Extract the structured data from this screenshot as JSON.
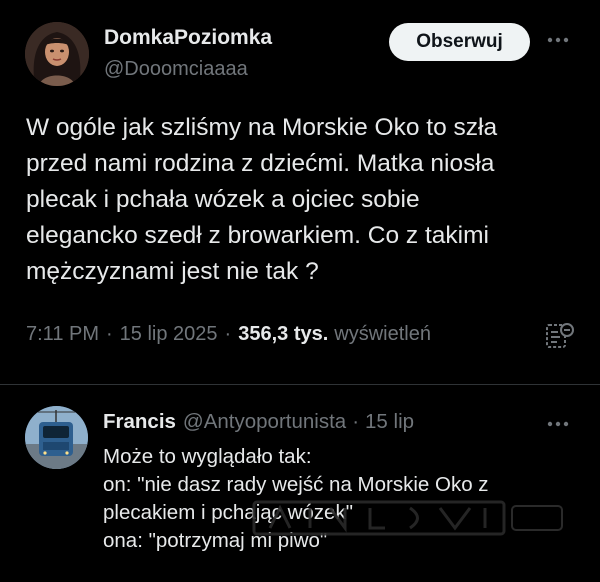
{
  "main_tweet": {
    "author_name": "DomkaPoziomka",
    "author_handle": "@Dooomciaaaa",
    "follow_label": "Obserwuj",
    "text_lines": [
      "W ogóle jak szliśmy na Morskie Oko to szła",
      "przed nami rodzina z dziećmi. Matka niosła",
      "plecak i pchała wózek a ojciec sobie",
      "elegancko szedł z browarkiem. Co z takimi",
      "mężczyznami jest nie tak ?"
    ],
    "time": "7:11 PM",
    "date": "15 lip 2025",
    "separator": "·",
    "views_count": "356,3 tys.",
    "views_label": "wyświetleń",
    "icons": {
      "more": "more-horizontal-icon",
      "analytics": "analytics-icon"
    }
  },
  "reply": {
    "author_name": "Francis",
    "author_handle": "@Antyoportunista",
    "separator": "·",
    "date": "15 lip",
    "text_lines": [
      "Może to wyglądało tak:",
      "on: \"nie dasz rady wejść na Morskie Oko z",
      "plecakiem i pchając wózek\"",
      "ona: \"potrzymaj mi piwo\""
    ],
    "icons": {
      "more": "more-horizontal-icon"
    }
  },
  "colors": {
    "background": "#000000",
    "text_primary": "#e7e9ea",
    "text_secondary": "#71767b",
    "follow_button_bg": "#eff3f4",
    "follow_button_text": "#0f1419",
    "divider": "#2f3336"
  }
}
